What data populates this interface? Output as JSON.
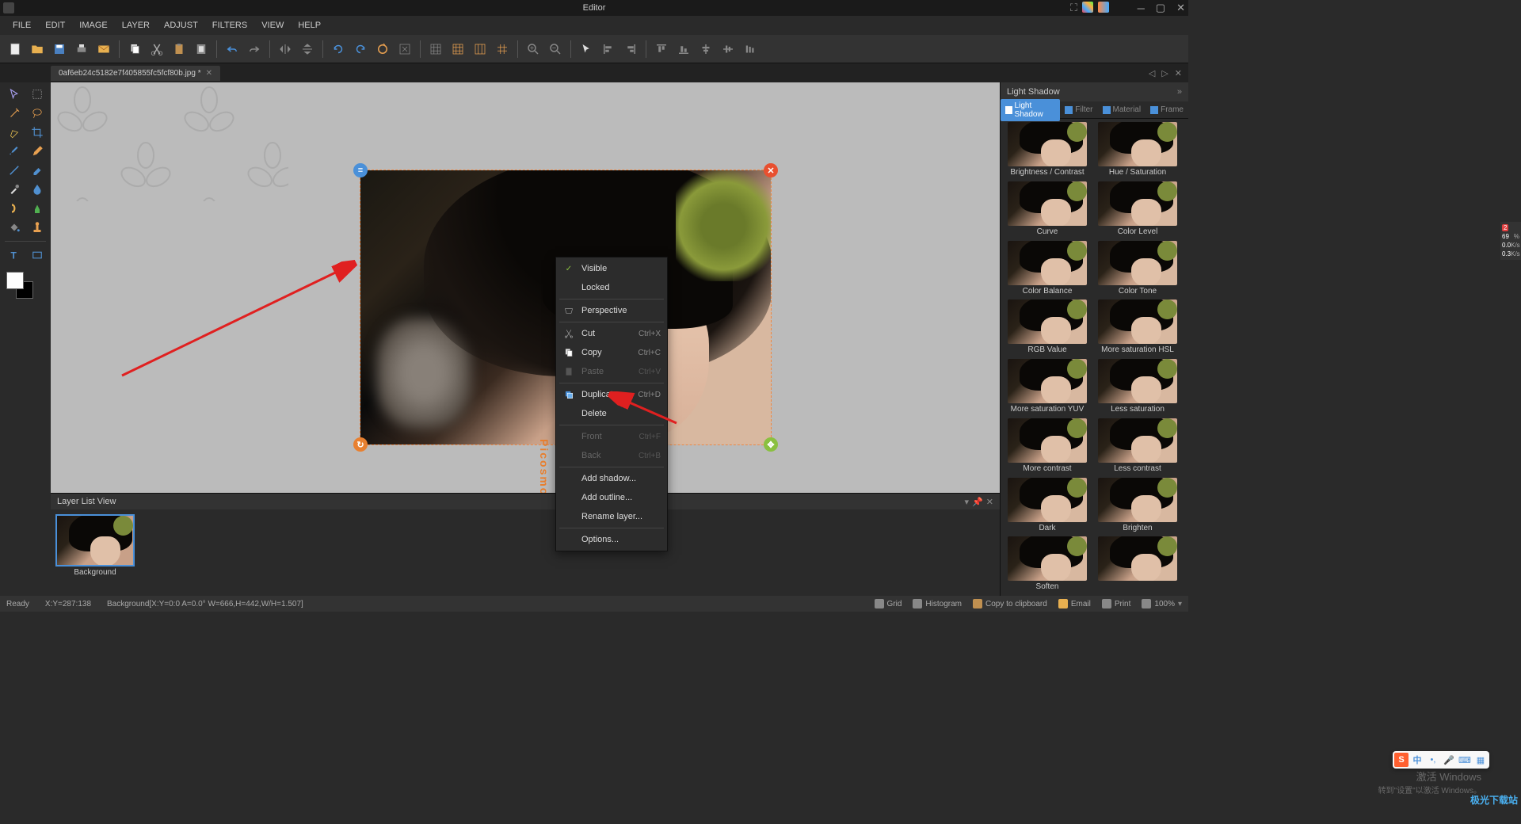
{
  "titlebar": {
    "title": "Editor"
  },
  "menubar": [
    "FILE",
    "EDIT",
    "IMAGE",
    "LAYER",
    "ADJUST",
    "FILTERS",
    "VIEW",
    "HELP"
  ],
  "tab": {
    "filename": "0af6eb24c5182e7f405855fc5fcf80b.jpg *"
  },
  "context_menu": [
    {
      "type": "item",
      "label": "Visible",
      "checked": true
    },
    {
      "type": "item",
      "label": "Locked"
    },
    {
      "type": "sep"
    },
    {
      "type": "item",
      "label": "Perspective",
      "icon": "perspective"
    },
    {
      "type": "sep"
    },
    {
      "type": "item",
      "label": "Cut",
      "shortcut": "Ctrl+X",
      "icon": "cut"
    },
    {
      "type": "item",
      "label": "Copy",
      "shortcut": "Ctrl+C",
      "icon": "copy"
    },
    {
      "type": "item",
      "label": "Paste",
      "shortcut": "Ctrl+V",
      "icon": "paste",
      "disabled": true
    },
    {
      "type": "sep"
    },
    {
      "type": "item",
      "label": "Duplicate",
      "shortcut": "Ctrl+D",
      "icon": "duplicate"
    },
    {
      "type": "item",
      "label": "Delete"
    },
    {
      "type": "sep"
    },
    {
      "type": "item",
      "label": "Front",
      "shortcut": "Ctrl+F",
      "disabled": true
    },
    {
      "type": "item",
      "label": "Back",
      "shortcut": "Ctrl+B",
      "disabled": true
    },
    {
      "type": "sep"
    },
    {
      "type": "item",
      "label": "Add shadow..."
    },
    {
      "type": "item",
      "label": "Add outline..."
    },
    {
      "type": "item",
      "label": "Rename layer..."
    },
    {
      "type": "sep"
    },
    {
      "type": "item",
      "label": "Options..."
    }
  ],
  "right_panel": {
    "title": "Light Shadow",
    "tabs": [
      "Light Shadow",
      "Filter",
      "Material",
      "Frame"
    ],
    "thumbs": [
      "Brightness / Contrast",
      "Hue / Saturation",
      "Curve",
      "Color Level",
      "Color Balance",
      "Color Tone",
      "RGB Value",
      "More saturation HSL",
      "More saturation YUV",
      "Less saturation",
      "More contrast",
      "Less contrast",
      "Dark",
      "Brighten",
      "Soften",
      ""
    ]
  },
  "layer_panel": {
    "title": "Layer List View",
    "layers": [
      {
        "name": "Background"
      }
    ]
  },
  "statusbar": {
    "ready": "Ready",
    "coords": "X:Y=287:138",
    "info": "Background[X:Y=0:0 A=0.0° W=666,H=442,W/H=1.507]",
    "right": [
      {
        "label": "Grid",
        "icon": "grid"
      },
      {
        "label": "Histogram",
        "icon": "histogram"
      },
      {
        "label": "Copy to clipboard",
        "icon": "clipboard"
      },
      {
        "label": "Email",
        "icon": "email"
      },
      {
        "label": "Print",
        "icon": "print"
      },
      {
        "label": "100%",
        "icon": "zoom"
      }
    ]
  },
  "watermark": "Picosmos",
  "network": {
    "badge": "2",
    "pct": "69",
    "v1": "0.0",
    "u1": "K/s",
    "v2": "0.3",
    "u2": "K/s"
  },
  "windows": {
    "line1": "激活 Windows",
    "line2": "转到\"设置\"以激活 Windows。"
  },
  "ime": {
    "s": "S",
    "zh": "中"
  },
  "corner": "极光下载站"
}
